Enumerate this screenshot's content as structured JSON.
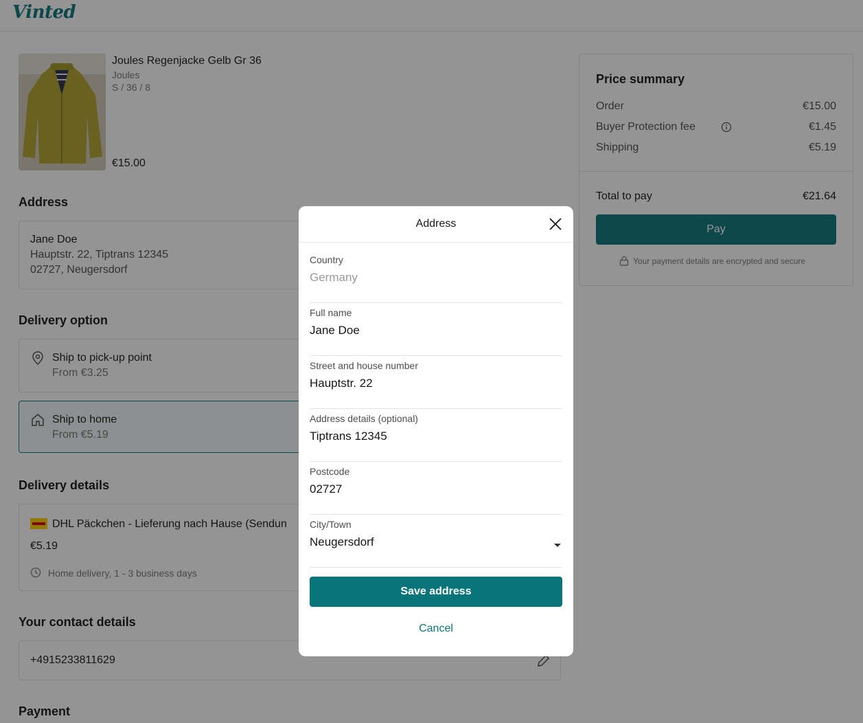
{
  "header": {
    "logo": "Vinted"
  },
  "item": {
    "title": "Joules Regenjacke Gelb Gr 36",
    "brand": "Joules",
    "size": "S / 36 / 8",
    "price": "€15.00"
  },
  "address": {
    "section_title": "Address",
    "name": "Jane Doe",
    "line1": "Hauptstr. 22, Tiptrans 12345",
    "line2": "02727, Neugersdorf"
  },
  "delivery_option": {
    "section_title": "Delivery option",
    "options": [
      {
        "title": "Ship to pick-up point",
        "sub": "From €3.25",
        "icon": "location-pin-icon"
      },
      {
        "title": "Ship to home",
        "sub": "From €5.19",
        "icon": "home-icon"
      }
    ]
  },
  "delivery_details": {
    "section_title": "Delivery details",
    "carrier": "DHL Päckchen - Lieferung nach Hause (Sendun",
    "price": "€5.19",
    "eta": "Home delivery, 1 - 3 business days"
  },
  "contact": {
    "section_title": "Your contact details",
    "phone": "+4915233811629"
  },
  "payment": {
    "section_title": "Payment"
  },
  "summary": {
    "title": "Price summary",
    "rows": [
      {
        "label": "Order",
        "value": "€15.00"
      },
      {
        "label": "Buyer Protection fee",
        "value": "€1.45"
      },
      {
        "label": "Shipping",
        "value": "€5.19"
      }
    ],
    "total_label": "Total to pay",
    "total_value": "€21.64",
    "pay_label": "Pay",
    "secure_text": "Your payment details are encrypted and secure"
  },
  "modal": {
    "title": "Address",
    "fields": [
      {
        "label": "Country",
        "value": "Germany"
      },
      {
        "label": "Full name",
        "value": "Jane Doe"
      },
      {
        "label": "Street and house number",
        "value": "Hauptstr. 22"
      },
      {
        "label": "Address details (optional)",
        "value": "Tiptrans 12345"
      },
      {
        "label": "Postcode",
        "value": "02727"
      },
      {
        "label": "City/Town",
        "value": "Neugersdorf"
      }
    ],
    "save_label": "Save address",
    "cancel_label": "Cancel"
  },
  "colors": {
    "brand": "#09757a",
    "pay_button": "#09757a"
  }
}
